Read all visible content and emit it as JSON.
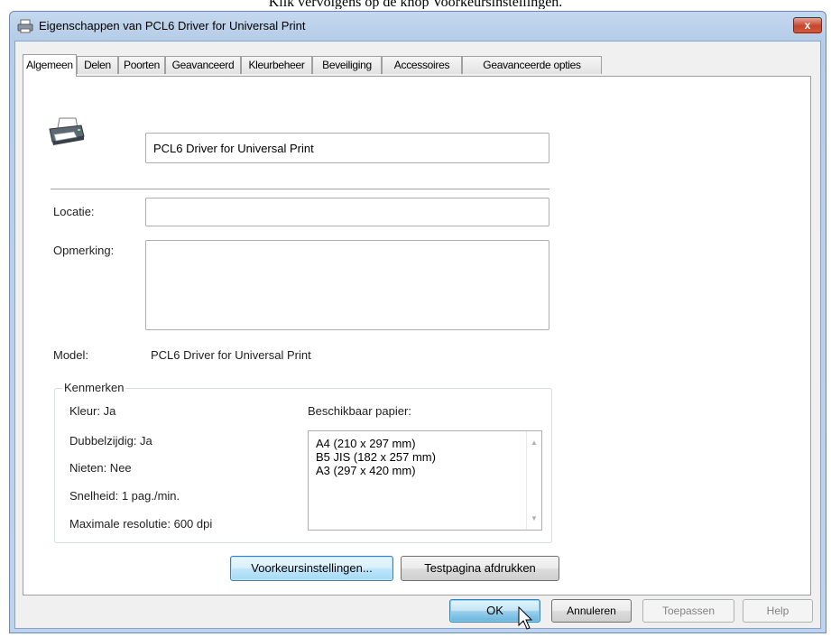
{
  "caption": "Klik vervolgens op de knop Voorkeursinstellingen.",
  "window": {
    "title": "Eigenschappen van PCL6 Driver for Universal Print",
    "close_glyph": "x"
  },
  "tabs": [
    {
      "label": "Algemeen",
      "active": true
    },
    {
      "label": "Delen"
    },
    {
      "label": "Poorten"
    },
    {
      "label": "Geavanceerd"
    },
    {
      "label": "Kleurbeheer"
    },
    {
      "label": "Beveiliging"
    },
    {
      "label": "Accessoires"
    },
    {
      "label": "Geavanceerde opties"
    }
  ],
  "general": {
    "printer_name": "PCL6 Driver for Universal Print",
    "location_label": "Locatie:",
    "location_value": "",
    "comment_label": "Opmerking:",
    "comment_value": "",
    "model_label": "Model:",
    "model_value": "PCL6 Driver for Universal Print"
  },
  "features": {
    "group_title": "Kenmerken",
    "color": "Kleur: Ja",
    "duplex": "Dubbelzijdig: Ja",
    "staple": "Nieten: Nee",
    "speed": "Snelheid: 1 pag./min.",
    "resolution": "Maximale resolutie: 600 dpi",
    "paper_label": "Beschikbaar papier:",
    "paper_list": [
      "A4 (210 x 297 mm)",
      "B5 JIS (182 x 257 mm)",
      "A3 (297 x 420 mm)"
    ]
  },
  "actions": {
    "preferences": "Voorkeursinstellingen...",
    "test_page": "Testpagina afdrukken"
  },
  "footer": {
    "ok": "OK",
    "cancel": "Annuleren",
    "apply": "Toepassen",
    "help": "Help"
  },
  "colors": {
    "focus_border": "#3c7fb1",
    "close_red": "#c8452c"
  }
}
